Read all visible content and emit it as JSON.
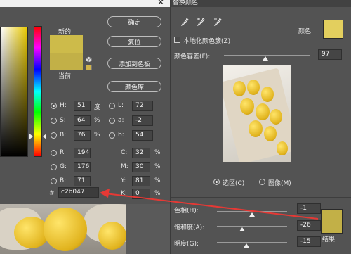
{
  "picker": {
    "labels": {
      "new": "新的",
      "current": "当前"
    },
    "buttons": {
      "ok": "确定",
      "reset": "复位",
      "add_to_swatches": "添加到色板",
      "color_libraries": "颜色库"
    },
    "hsb": [
      {
        "label": "H:",
        "value": "51",
        "unit": "度"
      },
      {
        "label": "S:",
        "value": "64",
        "unit": "%"
      },
      {
        "label": "B:",
        "value": "76",
        "unit": "%"
      }
    ],
    "rgb": [
      {
        "label": "R:",
        "value": "194"
      },
      {
        "label": "G:",
        "value": "176"
      },
      {
        "label": "B:",
        "value": "71"
      }
    ],
    "lab": [
      {
        "label": "L:",
        "value": "72"
      },
      {
        "label": "a:",
        "value": "-2"
      },
      {
        "label": "b:",
        "value": "54"
      }
    ],
    "cmyk": [
      {
        "label": "C:",
        "value": "32",
        "unit": "%"
      },
      {
        "label": "M:",
        "value": "30",
        "unit": "%"
      },
      {
        "label": "Y:",
        "value": "81",
        "unit": "%"
      },
      {
        "label": "K:",
        "value": "0",
        "unit": "%"
      }
    ],
    "hex": {
      "label": "#",
      "value": "c2b047"
    },
    "colors": {
      "new": "#cdbb4a",
      "current": "#c2b047"
    }
  },
  "replace": {
    "title": "替换颜色",
    "localized_clusters": "本地化颜色簇(Z)",
    "color_label": "颜色:",
    "fuzziness": {
      "label": "颜色容差(F):",
      "value": "97"
    },
    "view_options": {
      "selection": "选区(C)",
      "image": "图像(M)"
    },
    "hue": {
      "label": "色相(H):",
      "value": "-1"
    },
    "saturation": {
      "label": "饱和度(A):",
      "value": "-26"
    },
    "lightness": {
      "label": "明度(G):",
      "value": "-15"
    },
    "result_label": "结果",
    "colors": {
      "target": "#e3cf5e",
      "result": "#c2b047"
    }
  }
}
